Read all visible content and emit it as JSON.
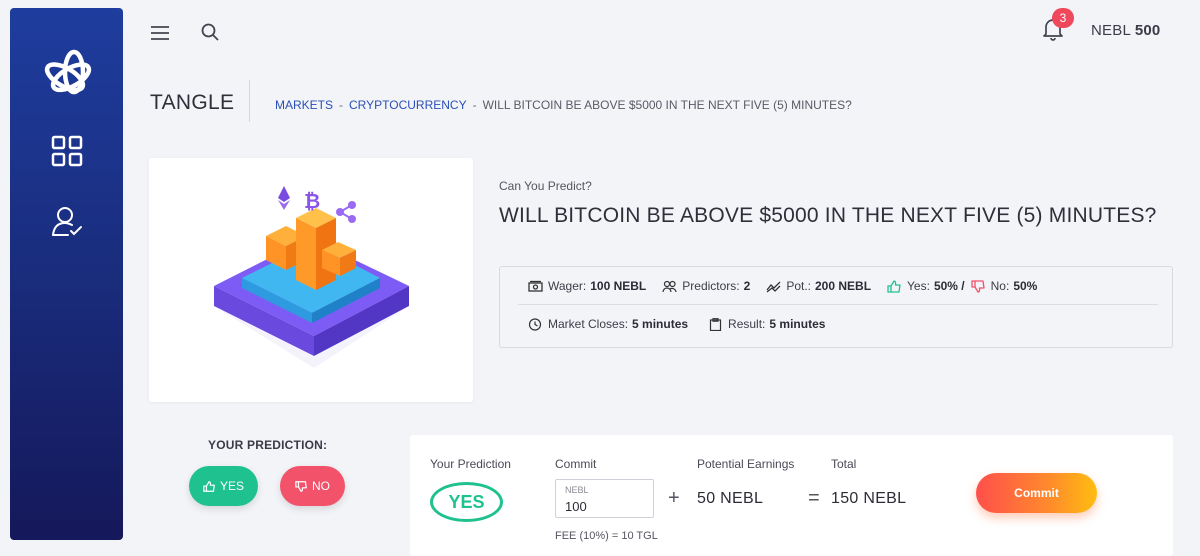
{
  "header": {
    "notification_count": "3",
    "balance_currency": "NEBL",
    "balance_amount": "500"
  },
  "page": {
    "brand": "TANGLE",
    "breadcrumb": [
      "MARKETS",
      "CRYPTOCURRENCY",
      "WILL BITCOIN BE ABOVE $5000 IN THE NEXT FIVE (5) MINUTES?"
    ]
  },
  "market": {
    "eyebrow": "Can You Predict?",
    "question": "WILL BITCOIN BE ABOVE $5000 IN THE NEXT FIVE (5) MINUTES?",
    "stats": {
      "wager_label": "Wager:",
      "wager_value": "100 NEBL",
      "predictors_label": "Predictors:",
      "predictors_value": "2",
      "pot_label": "Pot.:",
      "pot_value": "200 NEBL",
      "yes_label": "Yes:",
      "yes_value": "50% /",
      "no_label": "No:",
      "no_value": "50%",
      "closes_label": "Market Closes:",
      "closes_value": "5 minutes",
      "result_label": "Result:",
      "result_value": "5 minutes"
    }
  },
  "prediction": {
    "title": "YOUR PREDICTION:",
    "yes_label": "YES",
    "no_label": "NO"
  },
  "commit": {
    "your_prediction_label": "Your Prediction",
    "your_prediction_value": "YES",
    "commit_label": "Commit",
    "input_unit": "NEBL",
    "input_value": "100",
    "fee": "FEE (10%) = 10 TGL",
    "plus": "+",
    "potential_label": "Potential Earnings",
    "potential_value": "50 NEBL",
    "equals": "=",
    "total_label": "Total",
    "total_value": "150 NEBL",
    "button_label": "Commit"
  },
  "colors": {
    "sidebar_top": "#1e3d9e",
    "sidebar_bottom": "#15185a",
    "yes": "#1fc28f",
    "no": "#f2526a",
    "link": "#2a4fb5",
    "commit_gradient": [
      "#ff4f4b",
      "#ffbd10"
    ]
  },
  "icons": {
    "sidebar": [
      "openai-knot-logo",
      "grid-icon",
      "user-check-icon"
    ],
    "topbar": [
      "menu-icon",
      "search-icon",
      "bell-icon"
    ],
    "stats": [
      "cash-icon",
      "users-icon",
      "trend-icon",
      "thumbs-up-icon",
      "thumbs-down-icon",
      "clock-icon",
      "clipboard-icon"
    ]
  }
}
